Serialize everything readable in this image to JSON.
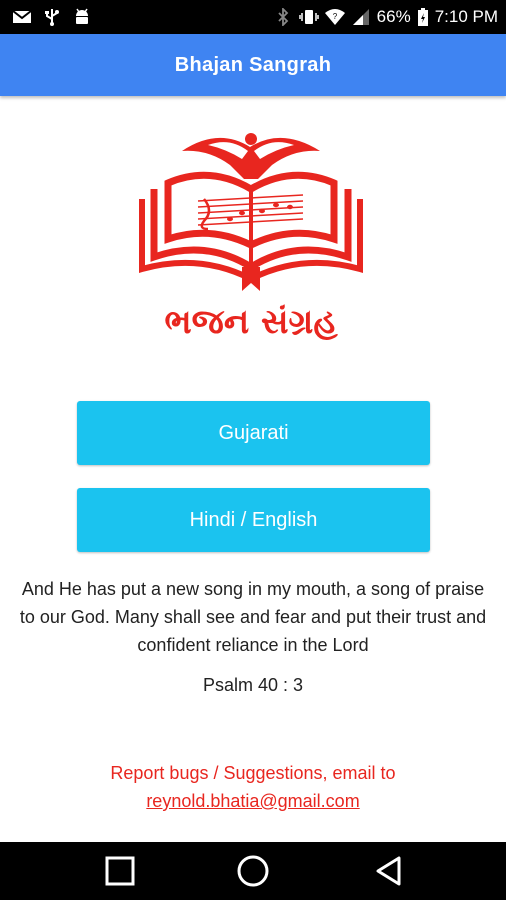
{
  "status_bar": {
    "battery_percent": "66%",
    "time": "7:10 PM",
    "icons": [
      "gmail-icon",
      "usb-icon",
      "android-icon",
      "bluetooth-icon",
      "vibrate-icon",
      "wifi-icon",
      "signal-icon",
      "battery-icon"
    ]
  },
  "toolbar": {
    "title": "Bhajan Sangrah"
  },
  "logo": {
    "text": "ભજન સંગ્રહ",
    "color": "#e8261f"
  },
  "buttons": {
    "gujarati": "Gujarati",
    "hindi_english": "Hindi / English"
  },
  "verse": {
    "text": "And He has put a new song in my mouth, a song of praise to our God. Many shall see and fear and put their trust and confident reliance in the Lord",
    "reference": "Psalm 40 : 3"
  },
  "footer": {
    "report_text": "Report bugs / Suggestions, email to",
    "email": "reynold.bhatia@gmail.com"
  },
  "nav_bar": {
    "icons": [
      "recents-icon",
      "home-icon",
      "back-icon"
    ]
  },
  "colors": {
    "toolbar": "#3f84f2",
    "button": "#1bc3ef",
    "accent": "#e8261f"
  }
}
